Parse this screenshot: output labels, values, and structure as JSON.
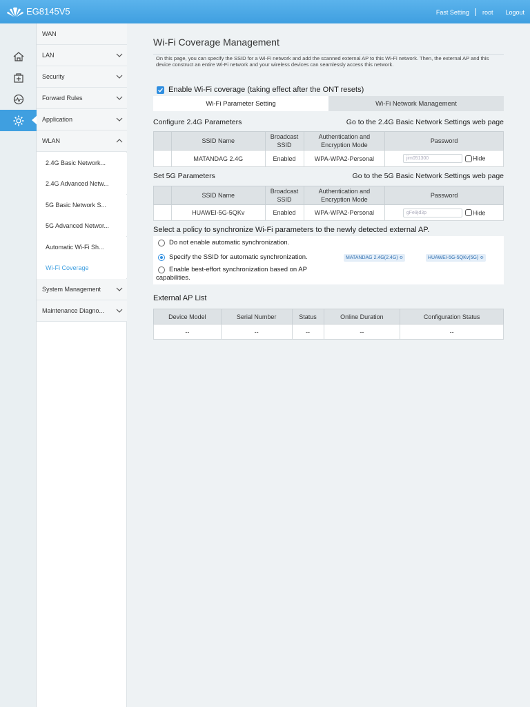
{
  "header": {
    "model": "EG8145V5",
    "links": [
      "Fast Setting",
      "root",
      "Logout"
    ]
  },
  "rail": {
    "icons": [
      "home-icon",
      "plus-box-icon",
      "monitor-icon",
      "gear-icon"
    ],
    "active": "gear-icon"
  },
  "menu": {
    "items": [
      {
        "label": "WAN",
        "chevron": "none"
      },
      {
        "label": "LAN",
        "chevron": "down"
      },
      {
        "label": "Security",
        "chevron": "down"
      },
      {
        "label": "Forward Rules",
        "chevron": "down"
      },
      {
        "label": "Application",
        "chevron": "down"
      },
      {
        "label": "WLAN",
        "chevron": "up"
      }
    ],
    "sub_items": [
      {
        "label": "2.4G Basic Network..."
      },
      {
        "label": "2.4G Advanced Netw..."
      },
      {
        "label": "5G Basic Network S..."
      },
      {
        "label": "5G Advanced Networ..."
      },
      {
        "label": "Automatic Wi-Fi Sh..."
      },
      {
        "label": "Wi-Fi Coverage",
        "active": true
      }
    ],
    "bottom_items": [
      {
        "label": "System Management",
        "chevron": "down"
      },
      {
        "label": "Maintenance Diagno...",
        "chevron": "down"
      }
    ]
  },
  "page": {
    "title": "Wi-Fi Coverage Management",
    "intro": "On this page, you can specify the SSID for a Wi-Fi network and add the scanned external AP to this Wi-Fi network. Then, the external AP and this device construct an entire Wi-Fi network and your wireless devices can seamlessly access this network.",
    "enable_label": "Enable Wi-Fi coverage (taking effect after the ONT resets)",
    "enable_checked": true,
    "tabs": [
      "Wi-Fi Parameter Setting",
      "Wi-Fi Network Management"
    ],
    "active_tab": 0
  },
  "section_24": {
    "title": "Configure 2.4G Parameters",
    "link": "Go to the 2.4G Basic Network Settings web page",
    "headers": [
      "SSID Name",
      "Broadcast SSID",
      "Authentication and Encryption Mode",
      "Password"
    ],
    "row": {
      "ssid": "MATANDAG 2.4G",
      "broadcast": "Enabled",
      "auth": "WPA-WPA2-Personal",
      "password": "jim051300",
      "hide_label": "Hide"
    }
  },
  "section_5": {
    "title": "Set 5G Parameters",
    "link": "Go to the 5G Basic Network Settings web page",
    "headers": [
      "SSID Name",
      "Broadcast SSID",
      "Authentication and Encryption Mode",
      "Password"
    ],
    "row": {
      "ssid": "HUAWEI-5G-5QKv",
      "broadcast": "Enabled",
      "auth": "WPA-WPA2-Personal",
      "password": "gFe9jd3p",
      "hide_label": "Hide"
    }
  },
  "policy": {
    "title": "Select a policy to synchronize Wi-Fi parameters to the newly detected external AP.",
    "options": [
      "Do not enable automatic synchronization.",
      "Specify the SSID for automatic synchronization.",
      "Enable best-effort synchronization based on AP capabilities."
    ],
    "selected": 1,
    "ssid_select_24": "MATANDAG 2.4G(2.4G) ≎",
    "ssid_select_5": "HUAWEI-5G-5QKv(5G) ≎"
  },
  "external_ap": {
    "title": "External AP List",
    "headers": [
      "Device Model",
      "Serial Number",
      "Status",
      "Online Duration",
      "Configuration Status"
    ],
    "row": [
      "--",
      "--",
      "--",
      "--",
      "--"
    ]
  },
  "colors": {
    "accent": "#3f9fe0",
    "header": "#4aa8e6"
  }
}
